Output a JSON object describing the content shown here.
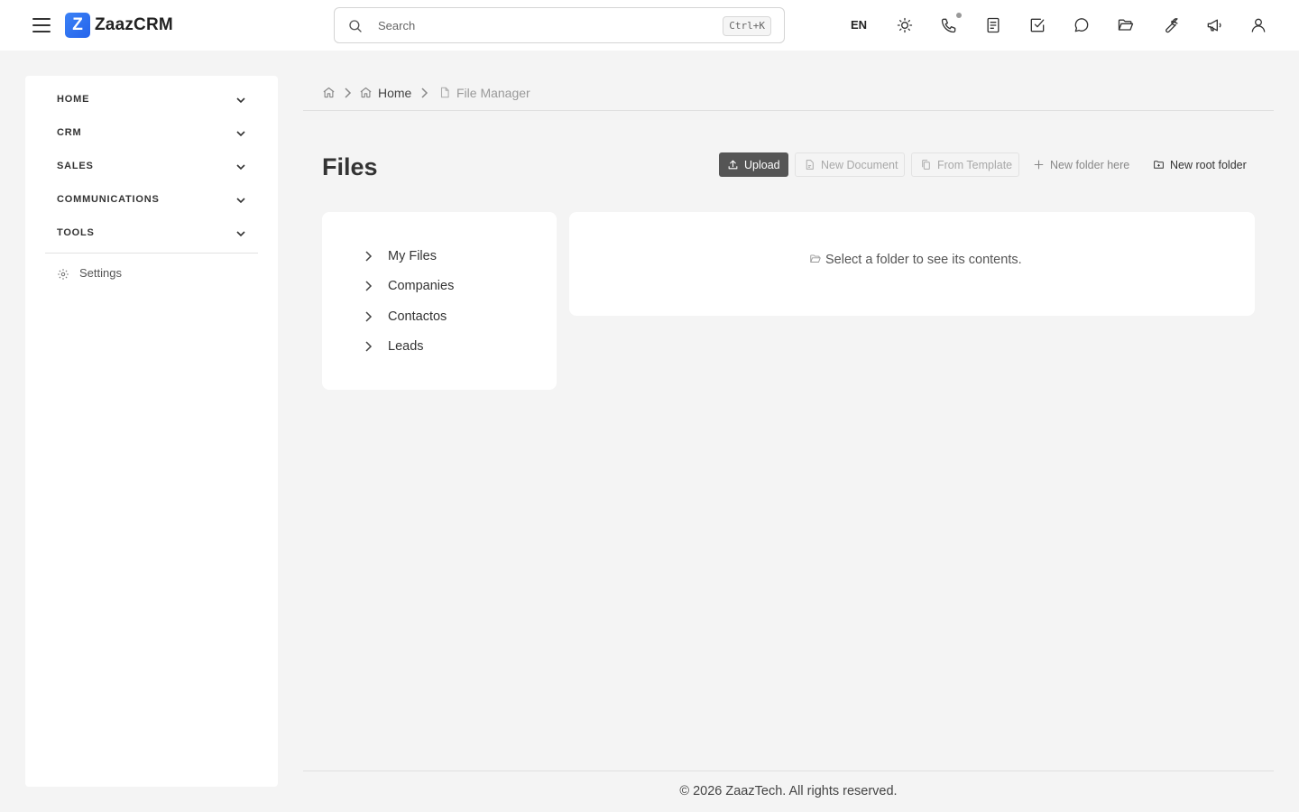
{
  "header": {
    "app_name": "ZaazCRM",
    "logo_letter": "Z",
    "search_placeholder": "Search",
    "search_shortcut": "Ctrl+K",
    "language": "EN",
    "icons": [
      "menu-icon",
      "sun-icon",
      "phone-icon",
      "notes-icon",
      "tasks-icon",
      "chat-icon",
      "folder-open-icon",
      "wrench-icon",
      "megaphone-icon",
      "user-icon"
    ]
  },
  "sidebar": {
    "items": [
      {
        "label": "HOME"
      },
      {
        "label": "CRM"
      },
      {
        "label": "SALES"
      },
      {
        "label": "COMMUNICATIONS"
      },
      {
        "label": "TOOLS"
      }
    ],
    "settings_label": "Settings"
  },
  "breadcrumb": {
    "home_label": "Home",
    "current_label": "File Manager"
  },
  "page": {
    "title": "Files",
    "toolbar": {
      "upload_label": "Upload",
      "new_document_label": "New Document",
      "from_template_label": "From Template",
      "new_folder_here_label": "New folder here",
      "new_root_folder_label": "New root folder"
    }
  },
  "folder_tree": {
    "items": [
      {
        "label": "My Files"
      },
      {
        "label": "Companies"
      },
      {
        "label": "Contactos"
      },
      {
        "label": "Leads"
      }
    ]
  },
  "content": {
    "empty_message": "Select a folder to see its contents."
  },
  "footer": {
    "text": "© 2026 ZaazTech. All rights reserved."
  },
  "colors": {
    "brand": "#3b82f6",
    "primary_button": "#555555",
    "background": "#f4f4f4"
  }
}
